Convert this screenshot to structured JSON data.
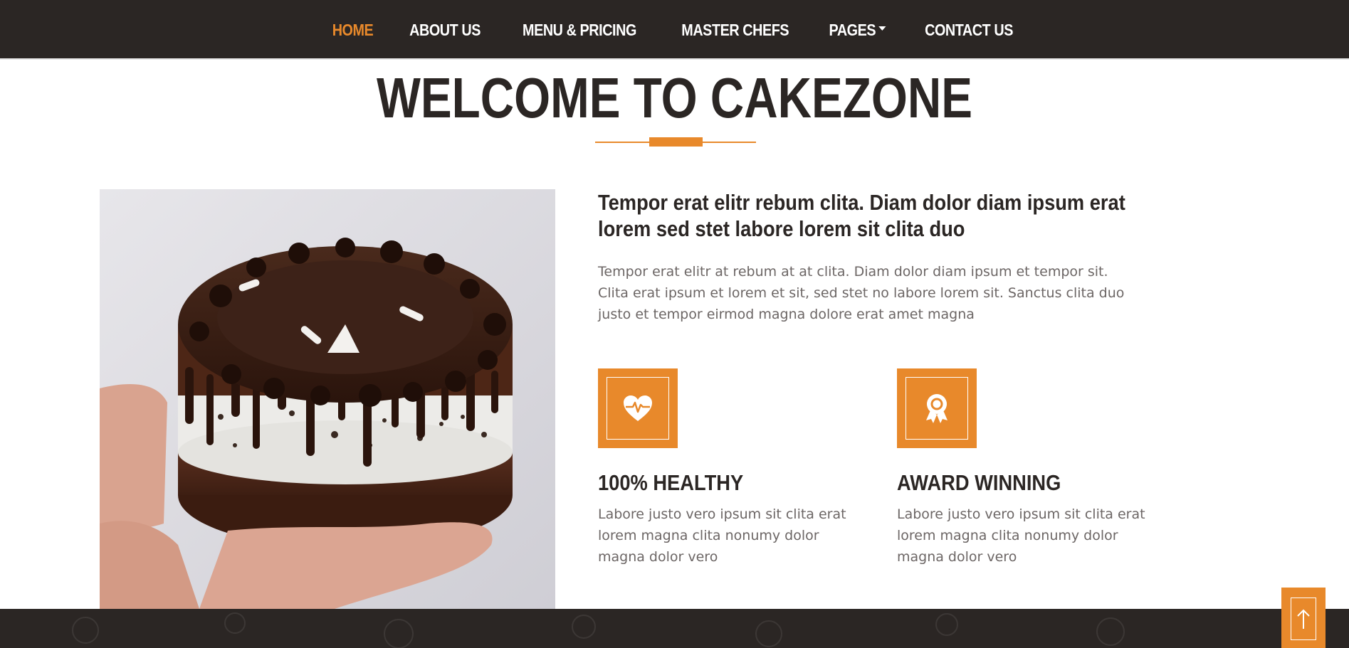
{
  "nav": {
    "items": [
      {
        "label": "HOME",
        "active": true
      },
      {
        "label": "ABOUT US",
        "active": false
      },
      {
        "label": "MENU & PRICING",
        "active": false
      },
      {
        "label": "MASTER CHEFS",
        "active": false
      },
      {
        "label": "PAGES",
        "active": false,
        "dropdown": true
      },
      {
        "label": "CONTACT US",
        "active": false
      }
    ]
  },
  "page": {
    "title": "WELCOME TO CAKEZONE"
  },
  "about": {
    "heading": "Tempor erat elitr rebum clita. Diam dolor diam ipsum erat lorem sed stet labore lorem sit clita duo",
    "text": "Tempor erat elitr at rebum at at clita. Diam dolor diam ipsum et tempor sit. Clita erat ipsum et lorem et sit, sed stet no labore lorem sit. Sanctus clita duo justo et tempor eirmod magna dolore erat amet magna",
    "image_icon": "chocolate-cake-photo"
  },
  "features": [
    {
      "icon": "heart-pulse-icon",
      "title": "100% HEALTHY",
      "text": "Labore justo vero ipsum sit clita erat lorem magna clita nonumy dolor magna dolor vero"
    },
    {
      "icon": "award-icon",
      "title": "AWARD WINNING",
      "text": "Labore justo vero ipsum sit clita erat lorem magna clita nonumy dolor magna dolor vero"
    }
  ],
  "back_to_top": {
    "icon": "arrow-up-icon"
  },
  "colors": {
    "accent": "#e8892b",
    "dark": "#2b2624",
    "text_muted": "#6c6665"
  }
}
